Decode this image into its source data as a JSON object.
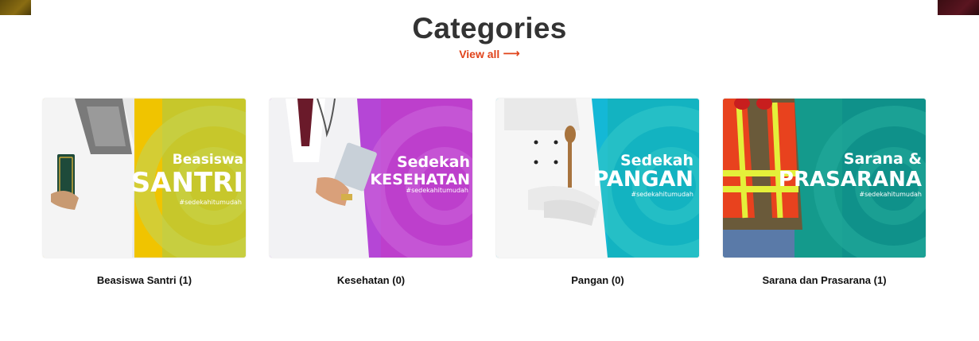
{
  "header": {
    "title": "Categories",
    "view_all_label": "View all",
    "view_all_arrow": "⟶"
  },
  "colors": {
    "title": "#333333",
    "accent": "#e0431a",
    "santri_bg": "#f0c400",
    "kesehatan_bg": "#b546d6",
    "pangan_bg": "#14b8d6",
    "prasarana_bg": "#149a8c"
  },
  "categories": [
    {
      "label": "Beasiswa Santri (1)",
      "banner_line1": "Beasiswa",
      "banner_line2": "SANTRI",
      "hashtag": "#sedekahitumudah",
      "icon": "santri-person-icon"
    },
    {
      "label": "Kesehatan (0)",
      "banner_line1": "Sedekah",
      "banner_line2": "KESEHATAN",
      "hashtag": "#sedekahitumudah",
      "icon": "doctor-icon"
    },
    {
      "label": "Pangan (0)",
      "banner_line1": "Sedekah",
      "banner_line2": "PANGAN",
      "hashtag": "#sedekahitumudah",
      "icon": "chef-icon"
    },
    {
      "label": "Sarana dan Prasarana (1)",
      "banner_line1": "Sarana &",
      "banner_line2": "PRASARANA",
      "hashtag": "#sedekahitumudah",
      "icon": "worker-icon"
    }
  ]
}
